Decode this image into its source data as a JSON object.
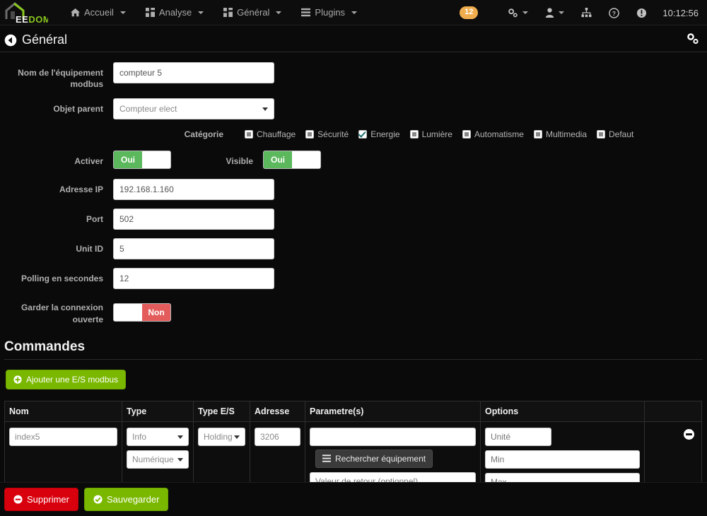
{
  "navbar": {
    "logo": {
      "part1": "EE",
      "part2": "DOM",
      "icon": "house-icon"
    },
    "menu": [
      {
        "label": "Accueil",
        "icon": "home-icon"
      },
      {
        "label": "Analyse",
        "icon": "dashboard-icon"
      },
      {
        "label": "Général",
        "icon": "dashboard-icon"
      },
      {
        "label": "Plugins",
        "icon": "list-icon"
      }
    ],
    "badge": "12",
    "icons": [
      {
        "name": "cogs-icon"
      },
      {
        "name": "user-icon"
      },
      {
        "name": "sitemap-icon"
      },
      {
        "name": "help-circle-icon"
      },
      {
        "name": "info-circle-icon"
      }
    ],
    "clock": "10:12:56"
  },
  "page": {
    "title": "Général",
    "back_icon": "arrow-circle-left-icon",
    "config_icon": "cogs-icon"
  },
  "form": {
    "name": {
      "label": "Nom de l'équipement modbus",
      "value": "compteur 5"
    },
    "parent": {
      "label": "Objet parent",
      "value": "Compteur elect"
    },
    "category": {
      "label": "Catégorie",
      "items": [
        {
          "label": "Chauffage",
          "checked": false
        },
        {
          "label": "Sécurité",
          "checked": false
        },
        {
          "label": "Energie",
          "checked": true
        },
        {
          "label": "Lumière",
          "checked": false
        },
        {
          "label": "Automatisme",
          "checked": false
        },
        {
          "label": "Multimedia",
          "checked": false
        },
        {
          "label": "Defaut",
          "checked": false
        }
      ]
    },
    "activer": {
      "label": "Activer",
      "value": "Oui"
    },
    "visible": {
      "label": "Visible",
      "value": "Oui"
    },
    "ip": {
      "label": "Adresse IP",
      "value": "192.168.1.160"
    },
    "port": {
      "label": "Port",
      "value": "502"
    },
    "unit_id": {
      "label": "Unit ID",
      "value": "5"
    },
    "polling": {
      "label": "Polling en secondes",
      "value": "12"
    },
    "keep_open": {
      "label": "Garder la connexion ouverte",
      "value": "Non"
    }
  },
  "commands": {
    "title": "Commandes",
    "add_button": {
      "label": "Ajouter une E/S modbus",
      "icon": "plus-circle-icon"
    },
    "columns": [
      "Nom",
      "Type",
      "Type E/S",
      "Adresse",
      "Parametre(s)",
      "Options",
      ""
    ],
    "rows": [
      {
        "nom": "index5",
        "type": "Info",
        "subtype": "Numérique",
        "type_es": "Holding",
        "adresse": "3206",
        "parametre": "",
        "search_button": {
          "label": "Rechercher équipement",
          "icon": "list-icon"
        },
        "retour_placeholder": "Valeur de retour (optionnel)",
        "unite_placeholder": "Unité",
        "min_placeholder": "Min",
        "max_placeholder": "Max",
        "remove_icon": "minus-circle-icon"
      }
    ]
  },
  "footer": {
    "delete": {
      "label": "Supprimer",
      "icon": "minus-circle-icon"
    },
    "save": {
      "label": "Sauvegarder",
      "icon": "check-circle-icon"
    }
  },
  "colors": {
    "brand_green": "#8ac81e",
    "button_green": "#7ab800",
    "toggle_green": "#5cb85c",
    "toggle_red": "#e35b5b",
    "danger_red": "#d9000d",
    "badge_orange": "#f0ad4e",
    "background": "#0a0a0a"
  }
}
